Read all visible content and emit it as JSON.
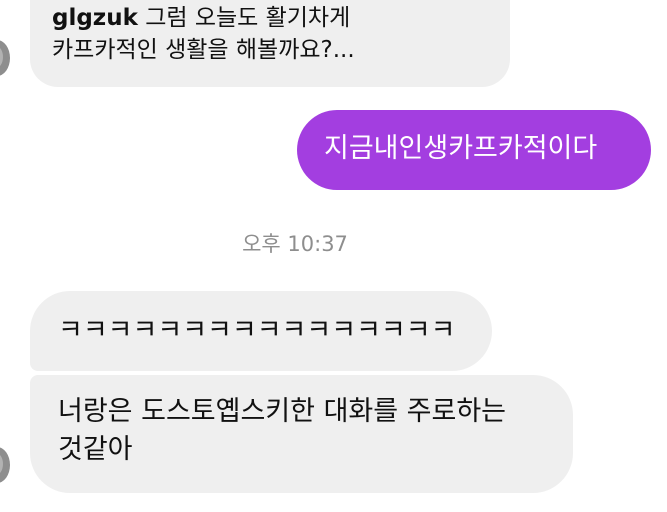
{
  "thread": {
    "reply_preview": {
      "username": "glgzuk",
      "line1_text": "그럼 오늘도 활기차게",
      "line2_text": "카프카적인 생활을 해볼까요?..."
    },
    "sent_message": "지금내인생카프카적이다",
    "timestamp": "오후 10:37",
    "received_messages": [
      {
        "text": "ㅋㅋㅋㅋㅋㅋㅋㅋㅋㅋㅋㅋㅋㅋㅋㅋ"
      },
      {
        "line1": "너랑은 도스토옙스키한 대화를 주로하는",
        "line2": "것같아"
      }
    ]
  },
  "colors": {
    "sent_bubble": "#a33ee0",
    "received_bubble": "#efefef",
    "timestamp_text": "#8e8e8e"
  }
}
